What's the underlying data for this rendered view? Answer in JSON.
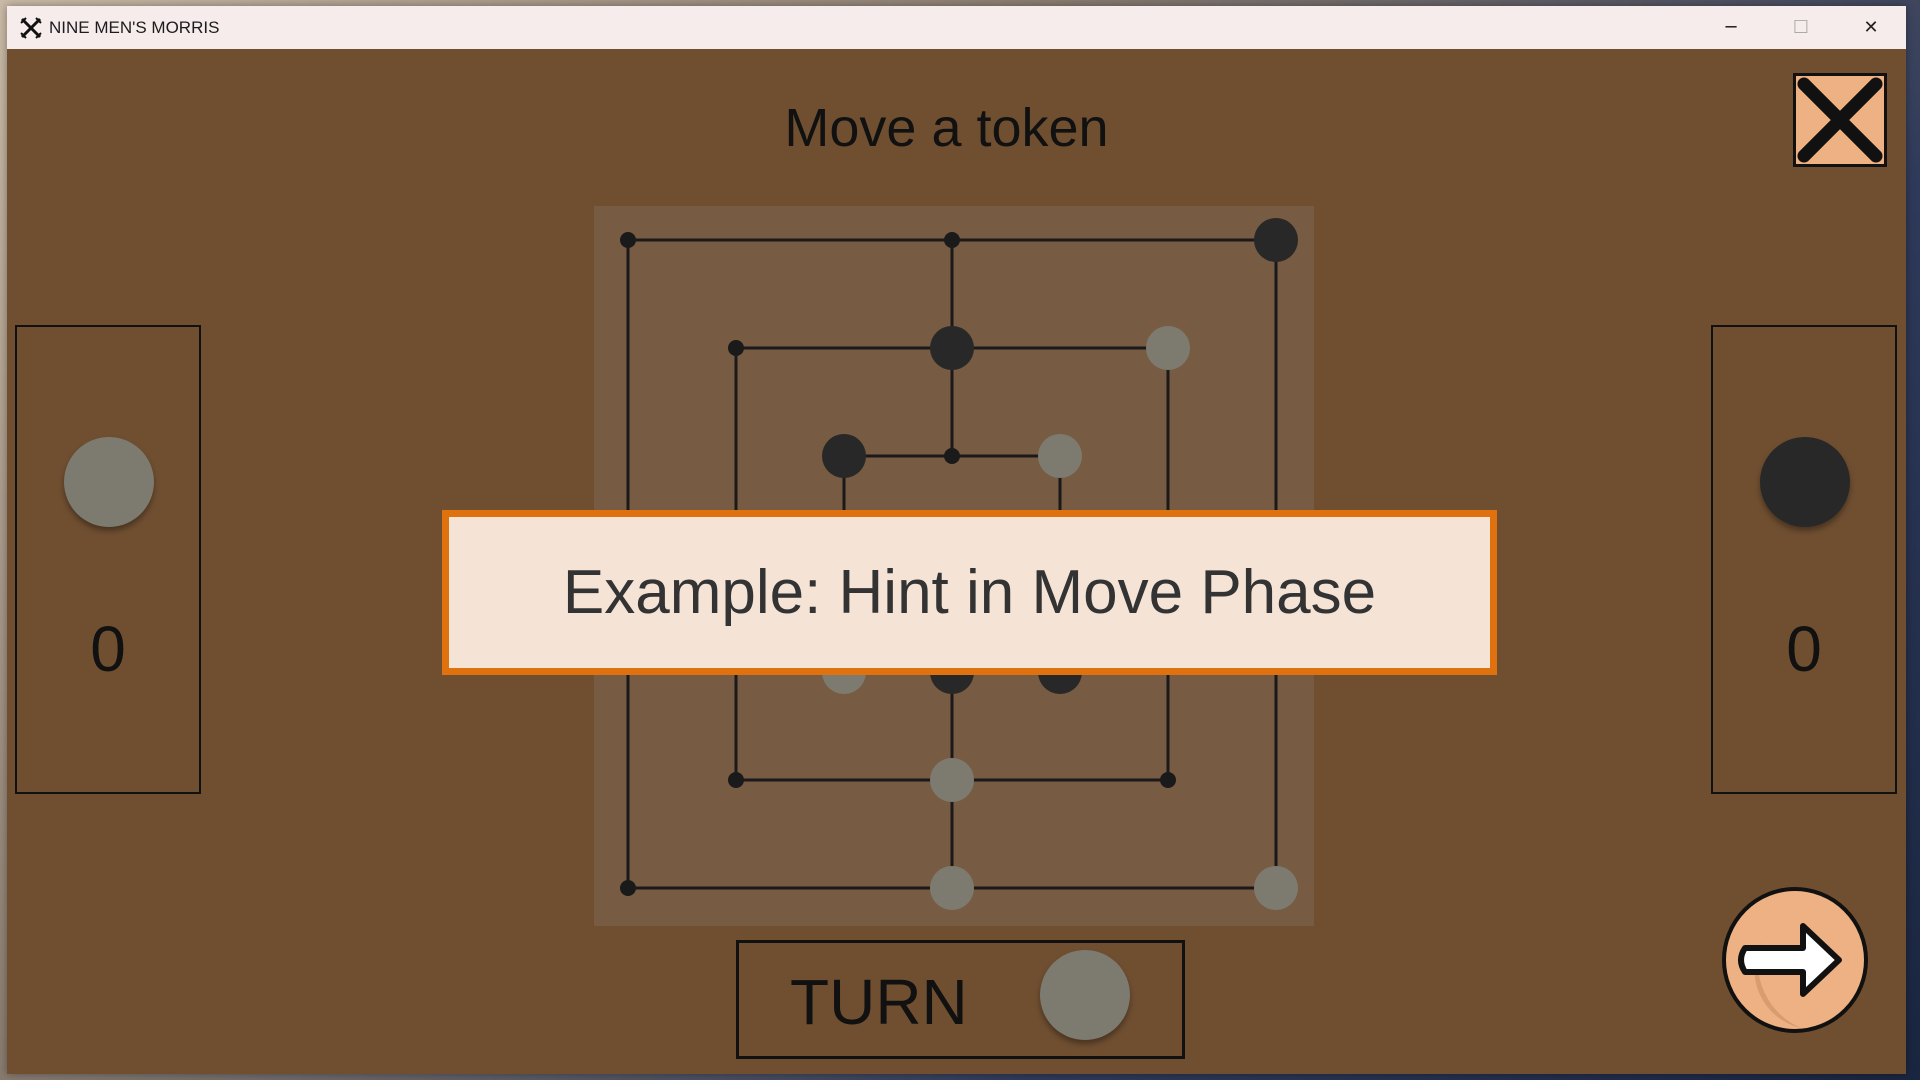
{
  "window": {
    "title": "NINE MEN'S MORRIS",
    "app_icon": "crossed-swords-icon",
    "controls": {
      "minimize": "─",
      "maximize": "☐",
      "close": "✕"
    }
  },
  "game": {
    "phase_title": "Move a token",
    "hint_text": "Example: Hint in Move Phase",
    "turn_label": "TURN",
    "turn_color": "light",
    "close_icon": "close-x-icon",
    "next_icon": "arrow-right-icon"
  },
  "players": {
    "left": {
      "color": "light",
      "score": "0"
    },
    "right": {
      "color": "dark",
      "score": "0"
    }
  },
  "colors": {
    "background": "#704f31",
    "board": "#775b42",
    "token_light": "#7d7b70",
    "token_dark": "#282828",
    "hint_bg": "#f5e3d6",
    "hint_border": "#e0710f",
    "accent": "#edb183"
  },
  "board": {
    "points": [
      {
        "id": "a7",
        "token": "none"
      },
      {
        "id": "d7",
        "token": "none"
      },
      {
        "id": "g7",
        "token": "dark"
      },
      {
        "id": "b6",
        "token": "none"
      },
      {
        "id": "d6",
        "token": "dark"
      },
      {
        "id": "f6",
        "token": "light"
      },
      {
        "id": "c5",
        "token": "dark"
      },
      {
        "id": "d5",
        "token": "none"
      },
      {
        "id": "e5",
        "token": "light"
      },
      {
        "id": "a4",
        "token": "none"
      },
      {
        "id": "b4",
        "token": "none"
      },
      {
        "id": "c4",
        "token": "none"
      },
      {
        "id": "e4",
        "token": "none"
      },
      {
        "id": "f4",
        "token": "none"
      },
      {
        "id": "g4",
        "token": "none"
      },
      {
        "id": "c3",
        "token": "light"
      },
      {
        "id": "d3",
        "token": "dark"
      },
      {
        "id": "e3",
        "token": "dark"
      },
      {
        "id": "b2",
        "token": "none"
      },
      {
        "id": "d2",
        "token": "light"
      },
      {
        "id": "f2",
        "token": "none"
      },
      {
        "id": "a1",
        "token": "none"
      },
      {
        "id": "d1",
        "token": "light"
      },
      {
        "id": "g1",
        "token": "light"
      }
    ]
  }
}
